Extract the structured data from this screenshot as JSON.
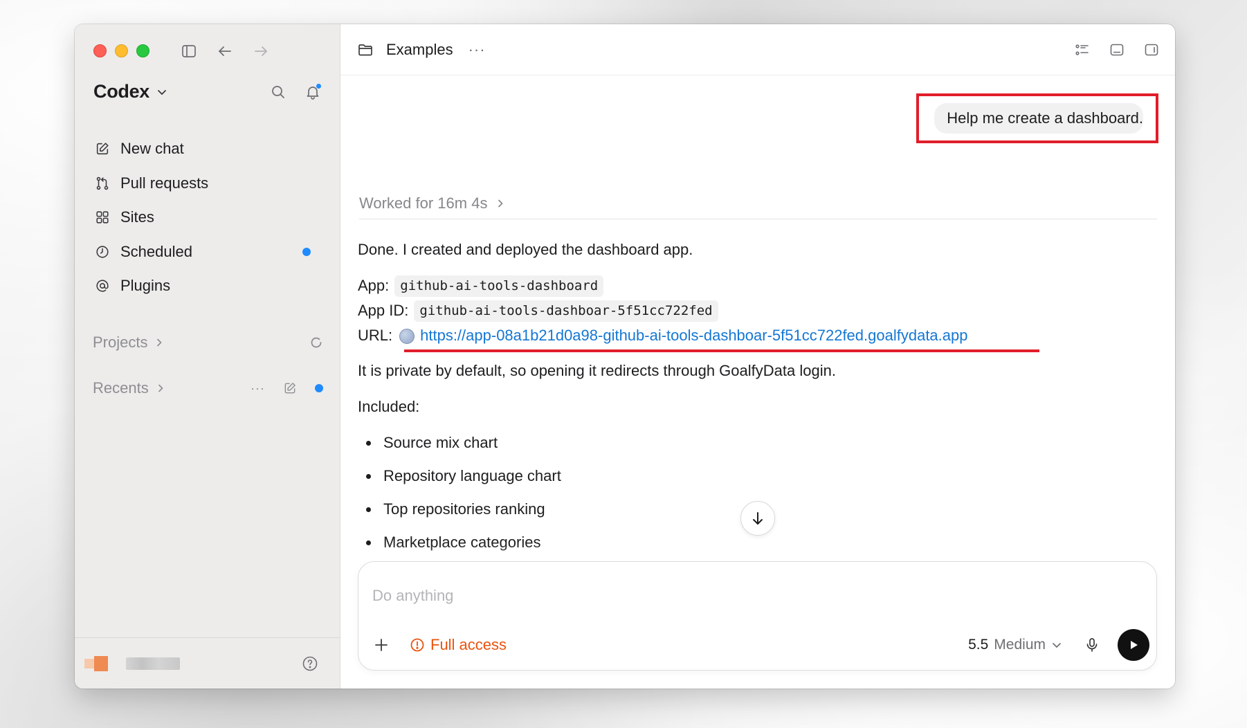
{
  "sidebar": {
    "brand": "Codex",
    "nav": [
      {
        "label": "New chat",
        "icon": "compose-icon"
      },
      {
        "label": "Pull requests",
        "icon": "pull-request-icon"
      },
      {
        "label": "Sites",
        "icon": "grid-icon"
      },
      {
        "label": "Scheduled",
        "icon": "clock-icon",
        "badge": true
      },
      {
        "label": "Plugins",
        "icon": "at-icon"
      }
    ],
    "projects_label": "Projects",
    "recents_label": "Recents"
  },
  "header": {
    "title": "Examples",
    "more": "···"
  },
  "conversation": {
    "user_message": "Help me create a dashboard.",
    "worked_for": "Worked for 16m 4s",
    "intro": "Done. I created and deployed the dashboard app.",
    "app_label": "App:",
    "app_value": "github-ai-tools-dashboard",
    "app_id_label": "App ID:",
    "app_id_value": "github-ai-tools-dashboar-5f51cc722fed",
    "url_label": "URL:",
    "url_value": "https://app-08a1b21d0a98-github-ai-tools-dashboar-5f51cc722fed.goalfydata.app",
    "privacy_note": "It is private by default, so opening it redirects through GoalfyData login.",
    "included_label": "Included:",
    "included_items": [
      "Source mix chart",
      "Repository language chart",
      "Top repositories ranking",
      "Marketplace categories"
    ]
  },
  "composer": {
    "placeholder": "Do anything",
    "access_label": "Full access",
    "model_version": "5.5",
    "model_effort": "Medium"
  },
  "colors": {
    "accent_blue": "#1f8bff",
    "link": "#1477d4",
    "highlight_red": "#e11d2a",
    "warning_orange": "#e8530e"
  }
}
